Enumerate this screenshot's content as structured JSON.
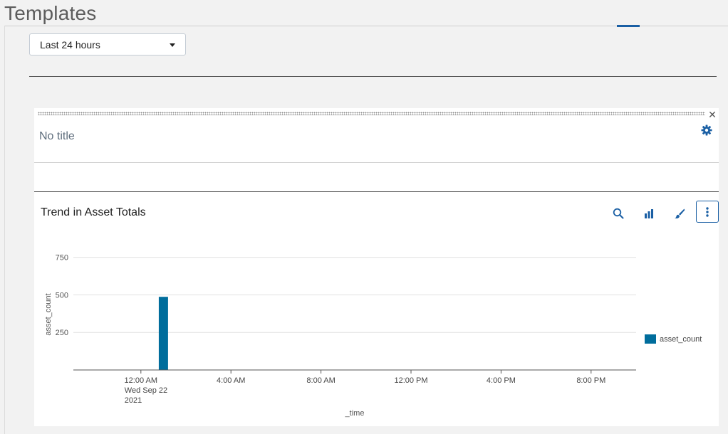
{
  "page": {
    "title": "Templates"
  },
  "timepicker": {
    "value": "Last 24 hours"
  },
  "panel_header": {
    "title": "No title"
  },
  "visualization": {
    "title": "Trend in Asset Totals"
  },
  "icons": {
    "close": "close-icon",
    "settings": "gear-icon",
    "search": "search-icon",
    "chart": "bar-chart-icon",
    "format": "paintbrush-icon",
    "more": "more-vertical-icon"
  },
  "colors": {
    "series": "#006d9c",
    "accent": "#1a5fa4"
  },
  "chart_data": {
    "type": "bar",
    "xlabel": "_time",
    "ylabel": "asset_count",
    "ylim": [
      0,
      900
    ],
    "yticks": [
      250,
      500,
      750
    ],
    "x_ticks": [
      {
        "label": "12:00 AM",
        "sub": [
          "Wed Sep 22",
          "2021"
        ]
      },
      {
        "label": "4:00 AM",
        "sub": []
      },
      {
        "label": "8:00 AM",
        "sub": []
      },
      {
        "label": "12:00 PM",
        "sub": []
      },
      {
        "label": "4:00 PM",
        "sub": []
      },
      {
        "label": "8:00 PM",
        "sub": []
      }
    ],
    "x_range_hours": [
      -3,
      22
    ],
    "series": [
      {
        "name": "asset_count",
        "points": [
          {
            "hour": 1,
            "value": 487
          }
        ]
      }
    ],
    "grid": true,
    "legend": "right"
  }
}
